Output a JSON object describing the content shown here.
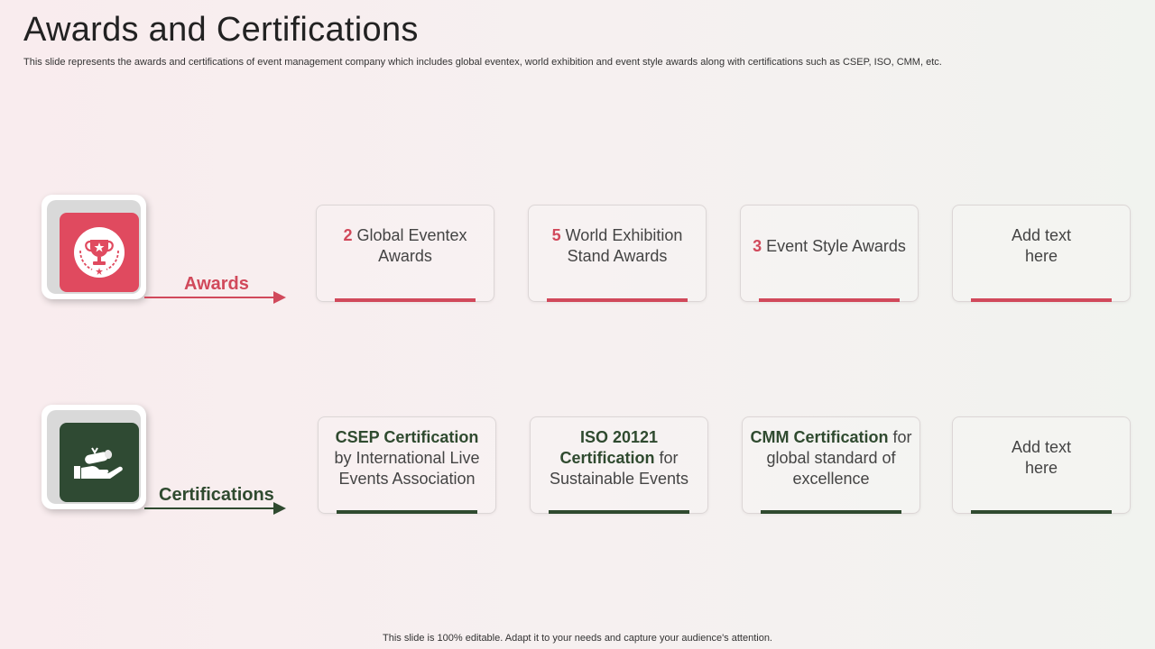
{
  "header": {
    "title": "Awards and Certifications",
    "subtitle": "This slide represents the awards and certifications of event management company which includes global eventex, world exhibition and event style awards along with certifications such as CSEP, ISO, CMM, etc."
  },
  "colors": {
    "awards_accent": "#d1495b",
    "certifications_accent": "#2f4a2f"
  },
  "awards": {
    "label": "Awards",
    "icon": "trophy-icon",
    "cards": [
      {
        "highlight": "2",
        "text": " Global Eventex Awards"
      },
      {
        "highlight": "5",
        "text": " World Exhibition Stand Awards"
      },
      {
        "highlight": "3",
        "text": " Event Style Awards"
      },
      {
        "highlight": "",
        "text": "Add text here"
      }
    ]
  },
  "certifications": {
    "label": "Certifications",
    "icon": "certificate-hand-icon",
    "cards": [
      {
        "highlight": "CSEP Certification",
        "text": " by International Live Events Association"
      },
      {
        "highlight": "ISO 20121 Certification",
        "text": " for Sustainable Events"
      },
      {
        "highlight": "CMM Certification",
        "text": " for global standard of excellence"
      },
      {
        "highlight": "",
        "text": "Add text here"
      }
    ]
  },
  "footer": {
    "text": "This slide is 100% editable. Adapt it to your needs and capture your audience's attention."
  }
}
